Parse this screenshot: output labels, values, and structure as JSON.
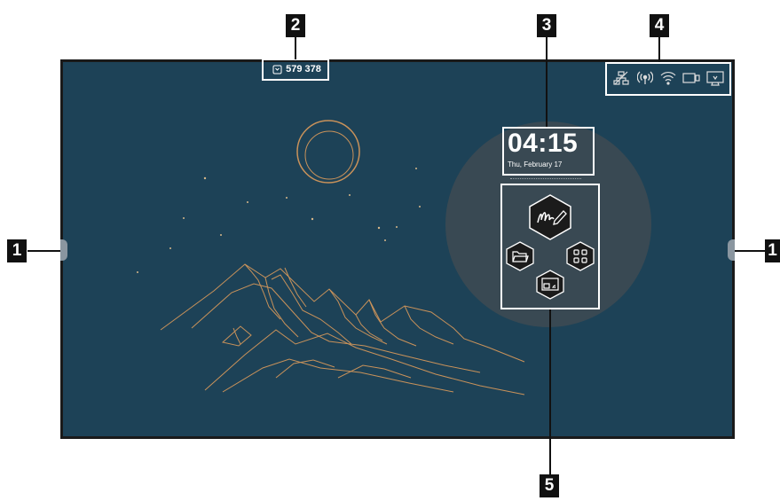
{
  "callouts": {
    "left": "1",
    "right": "1",
    "code": "2",
    "clock": "3",
    "status": "4",
    "apps": "5"
  },
  "screen_code": {
    "icon": "cast-code-icon",
    "value": "579 378"
  },
  "clock": {
    "time": "04:15",
    "date": "Thu, February 17"
  },
  "status_icons": [
    "ethernet-icon",
    "hotspot-icon",
    "wifi-icon",
    "screen-share-icon",
    "display-settings-icon"
  ],
  "apps": [
    "whiteboard-icon",
    "folder-icon",
    "apps-grid-icon",
    "screen-cast-icon"
  ],
  "colors": {
    "background": "#1d4257",
    "line_art": "#c9925a",
    "highlight": "#ffffff"
  }
}
